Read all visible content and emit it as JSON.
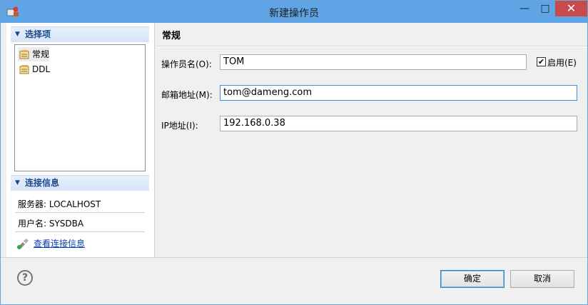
{
  "window": {
    "title": "新建操作员",
    "min_glyph": "—",
    "max_glyph": "□",
    "close_glyph": "✕"
  },
  "left": {
    "select_header": "选择项",
    "tree": [
      {
        "label": "常规"
      },
      {
        "label": "DDL"
      }
    ],
    "conn_header": "连接信息",
    "server": "服务器: LOCALHOST",
    "user": "用户名: SYSDBA",
    "view_link": "查看连接信息"
  },
  "right": {
    "title": "常规",
    "fields": [
      {
        "label": "操作员名(O):",
        "value": "TOM"
      },
      {
        "label": "邮箱地址(M):",
        "value": "tom@dameng.com"
      },
      {
        "label": "IP地址(I):",
        "value": "192.168.0.38"
      }
    ],
    "enable_check": "✔",
    "enable_label": "启用(E)"
  },
  "footer": {
    "help_glyph": "?",
    "ok": "确定",
    "cancel": "取消"
  },
  "colors": {
    "titlebar": "#5fa5e6",
    "close": "#c74b4b",
    "link": "#0b3db5",
    "section_header_text": "#1b4a8a"
  }
}
